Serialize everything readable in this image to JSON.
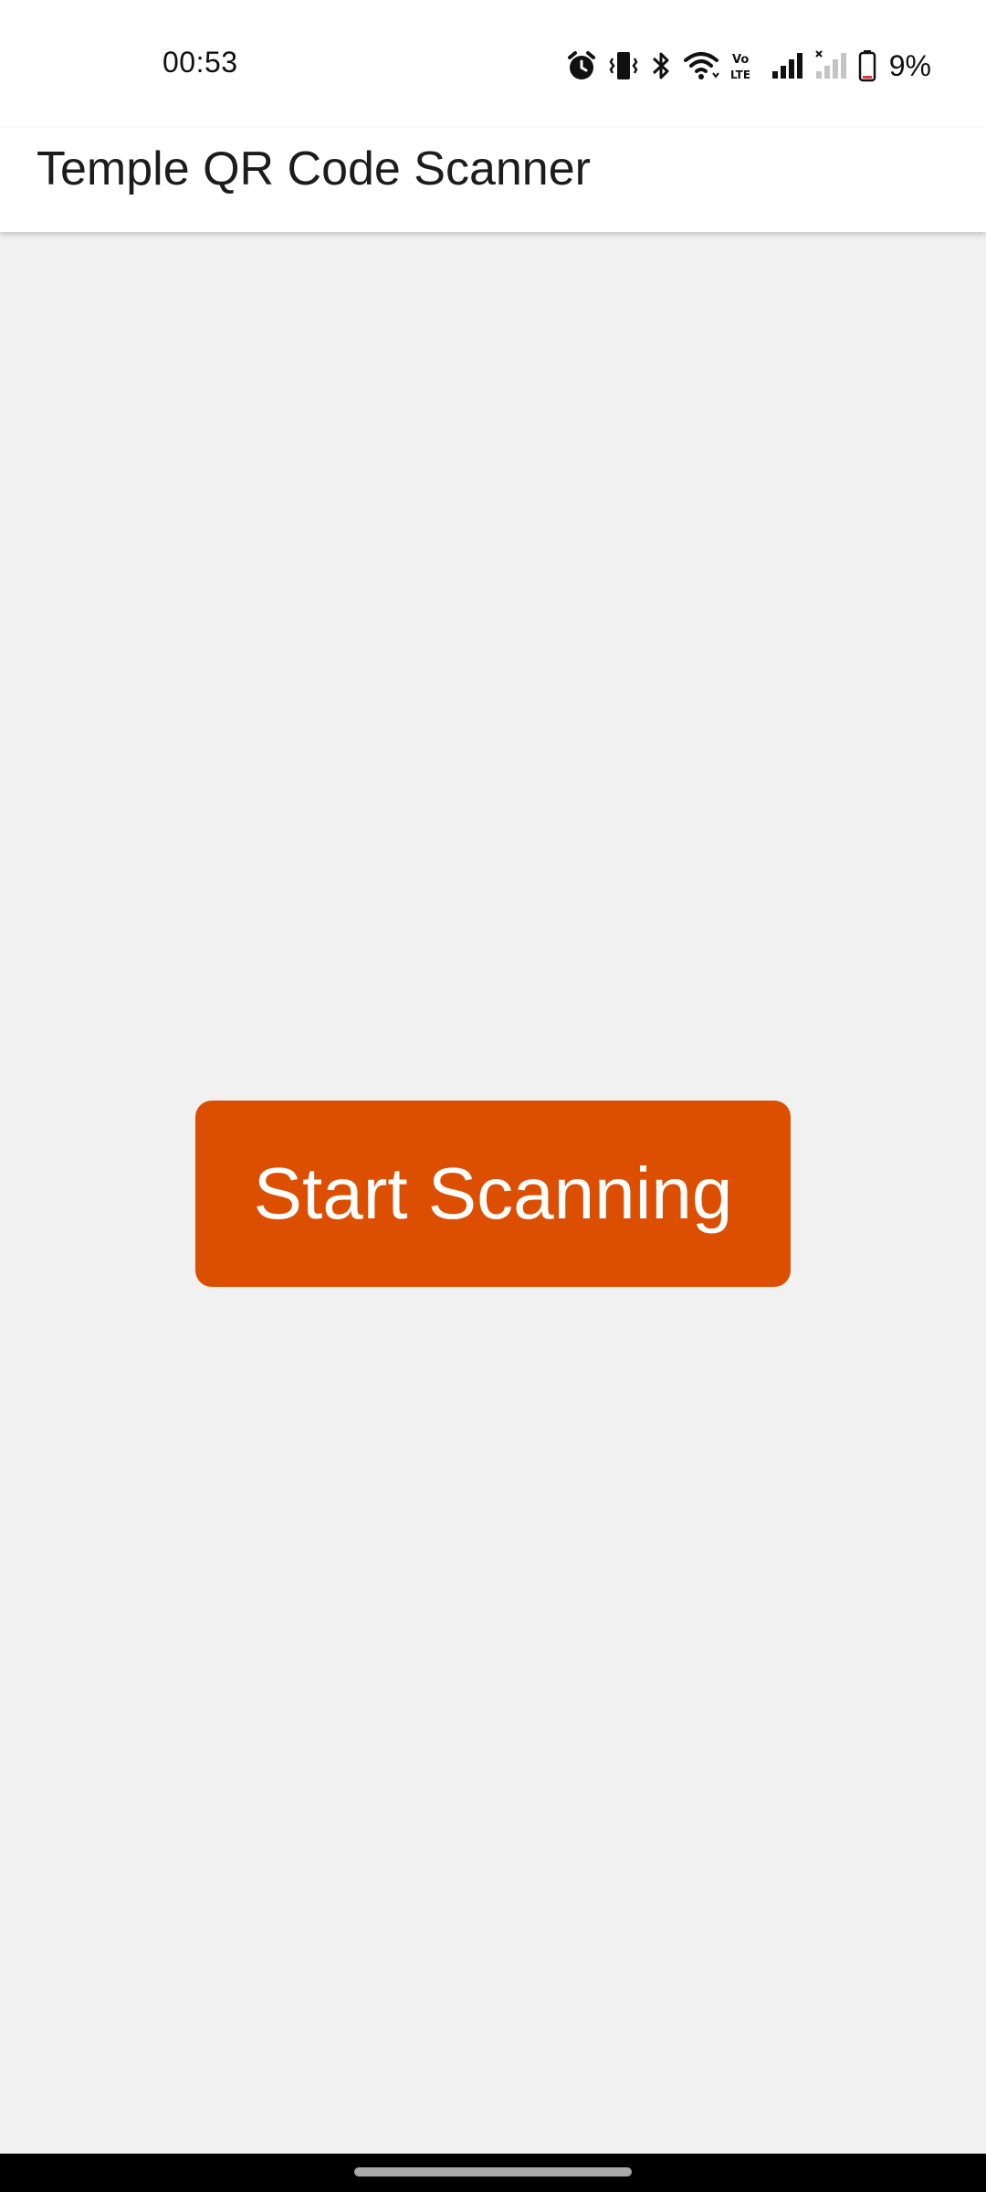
{
  "status_bar": {
    "time": "00:53",
    "battery_percent": "9%",
    "icons": [
      "alarm-icon",
      "vibrate-icon",
      "bluetooth-icon",
      "wifi-icon",
      "volte-icon",
      "signal-icon",
      "no-signal-icon",
      "battery-icon"
    ]
  },
  "app_bar": {
    "title": "Temple QR Code Scanner"
  },
  "main": {
    "start_button_label": "Start Scanning"
  },
  "colors": {
    "accent": "#dd4f00",
    "background": "#f1f1f1",
    "app_bar": "#ffffff"
  }
}
